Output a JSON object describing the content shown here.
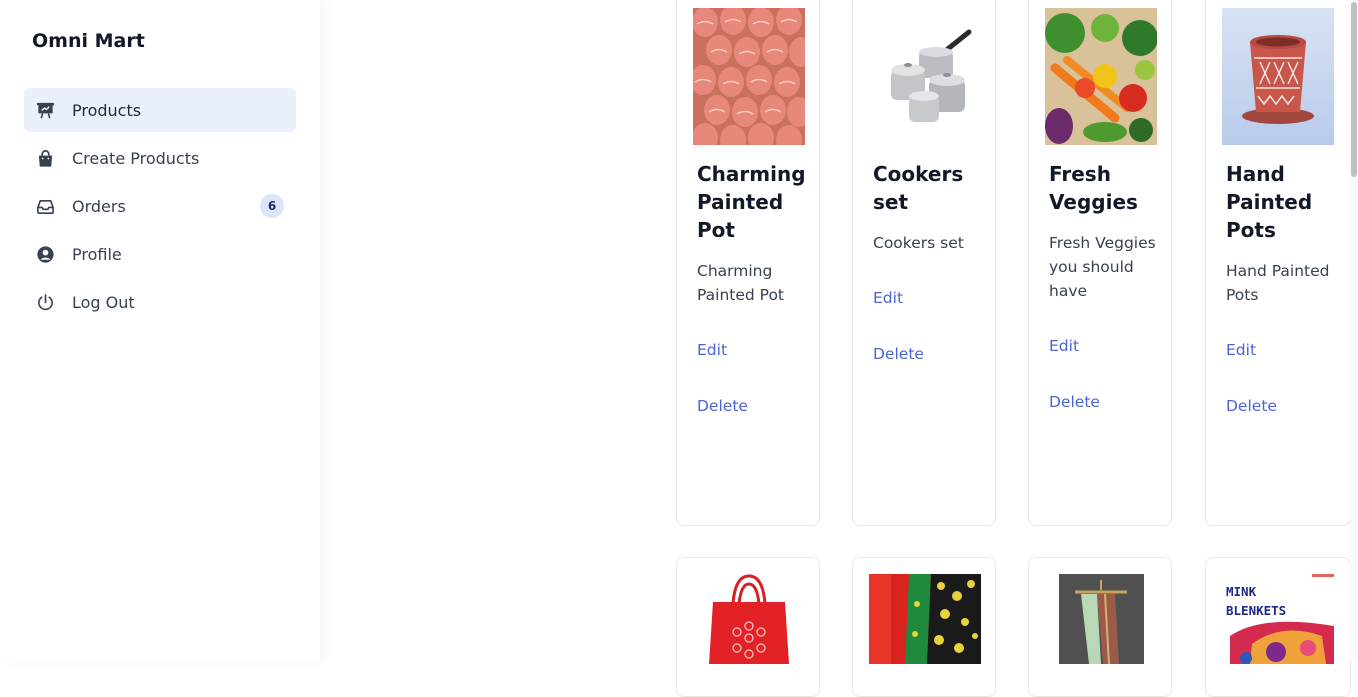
{
  "app": {
    "title": "Omni Mart"
  },
  "sidebar": {
    "items": [
      {
        "label": "Products",
        "icon": "presentation-chart-icon",
        "active": true
      },
      {
        "label": "Create Products",
        "icon": "shopping-bag-icon"
      },
      {
        "label": "Orders",
        "icon": "inbox-icon",
        "badge": "6"
      },
      {
        "label": "Profile",
        "icon": "user-circle-icon"
      },
      {
        "label": "Log Out",
        "icon": "power-icon"
      }
    ]
  },
  "products": [
    {
      "title": "Charming Painted Pot",
      "description": "Charming Painted Pot",
      "edit": "Edit",
      "delete": "Delete",
      "image": "painted-pots-image"
    },
    {
      "title": "Cookers set",
      "description": "Cookers set",
      "edit": "Edit",
      "delete": "Delete",
      "image": "cookware-image"
    },
    {
      "title": "Fresh Veggies",
      "description": "Fresh Veggies you should have",
      "edit": "Edit",
      "delete": "Delete",
      "image": "vegetables-image"
    },
    {
      "title": "Hand Painted Pots",
      "description": "Hand Painted Pots",
      "edit": "Edit",
      "delete": "Delete",
      "image": "red-pot-image"
    }
  ],
  "products_row2": [
    {
      "image": "red-bag-image"
    },
    {
      "image": "saree-fabric-image"
    },
    {
      "image": "saree-hanger-image"
    },
    {
      "image": "blanket-image",
      "image_text": "MINK BLENKETS"
    }
  ],
  "colors": {
    "accent": "#4a64d6",
    "active_bg": "#eaf1fd",
    "badge_bg": "#dbe4fb"
  }
}
